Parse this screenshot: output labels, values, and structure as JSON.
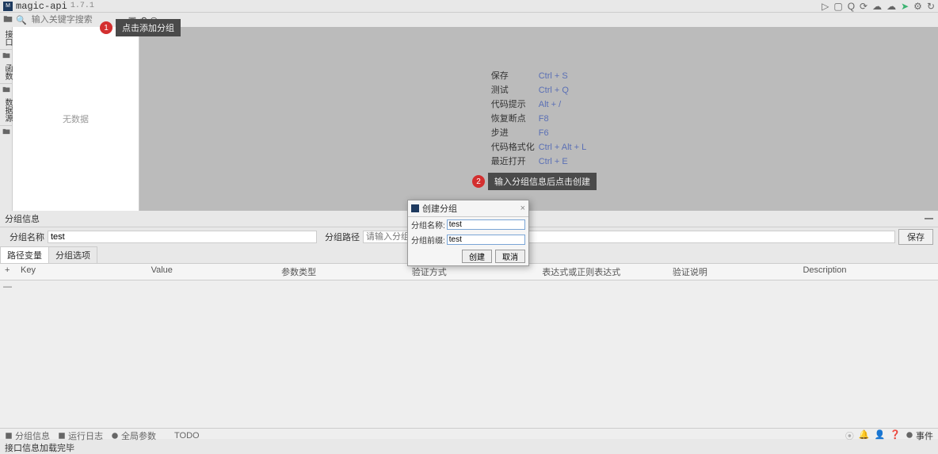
{
  "title": {
    "name": "magic-api",
    "version": "1.7.1"
  },
  "search": {
    "placeholder": "输入关键字搜索"
  },
  "sidebar": {
    "tabs": [
      "接口",
      "函数",
      "数据源"
    ]
  },
  "tree": {
    "empty": "无数据"
  },
  "hints": [
    {
      "label": "保存",
      "key": "Ctrl + S"
    },
    {
      "label": "测试",
      "key": "Ctrl + Q"
    },
    {
      "label": "代码提示",
      "key": "Alt + /"
    },
    {
      "label": "恢复断点",
      "key": "F8"
    },
    {
      "label": "步进",
      "key": "F6"
    },
    {
      "label": "代码格式化",
      "key": "Ctrl + Alt + L"
    },
    {
      "label": "最近打开",
      "key": "Ctrl + E"
    }
  ],
  "callouts": {
    "c1": {
      "num": "1",
      "text": "点击添加分组"
    },
    "c2": {
      "num": "2",
      "text": "输入分组信息后点击创建"
    }
  },
  "groupInfo": {
    "title": "分组信息",
    "nameLabel": "分组名称",
    "nameValue": "test",
    "pathLabel": "分组路径",
    "pathPlaceholder": "请输入分组路径",
    "saveBtn": "保存"
  },
  "paramTabs": [
    "路径变量",
    "分组选项"
  ],
  "tableHeaders": [
    "Key",
    "Value",
    "参数类型",
    "验证方式",
    "表达式或正则表达式",
    "验证说明",
    "Description"
  ],
  "footer": {
    "items": [
      "分组信息",
      "运行日志",
      "全局参数",
      "TODO"
    ],
    "event": "事件"
  },
  "status": "接口信息加载完毕",
  "dialog": {
    "title": "创建分组",
    "nameLabel": "分组名称:",
    "nameValue": "test",
    "prefixLabel": "分组前缀:",
    "prefixValue": "test",
    "create": "创建",
    "cancel": "取消"
  }
}
